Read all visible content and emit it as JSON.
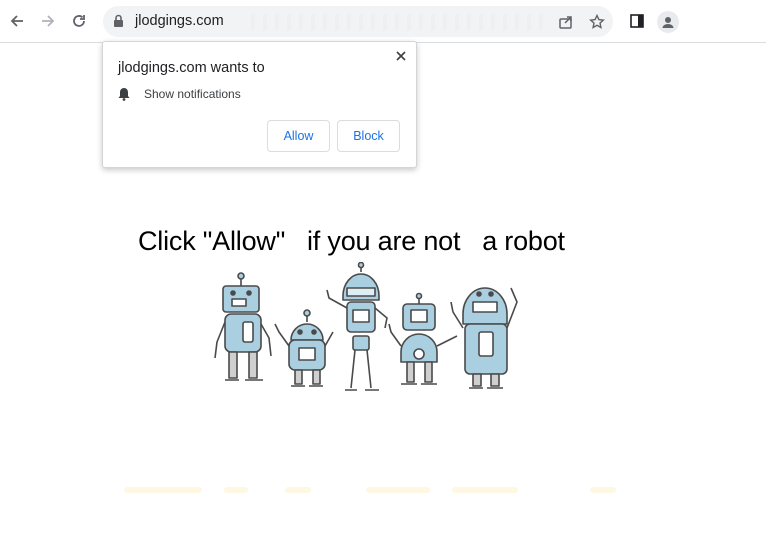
{
  "browser": {
    "url": "jlodgings.com",
    "icons": [
      "back-icon",
      "forward-icon",
      "reload-icon",
      "lock-icon",
      "share-icon",
      "bookmark-star-icon",
      "side-panel-icon",
      "profile-icon"
    ]
  },
  "popup": {
    "title": "jlodgings.com wants to",
    "permission": "Show notifications",
    "allow_label": "Allow",
    "block_label": "Block"
  },
  "page": {
    "headline": "Click \"Allow\"   if you are not   a robot"
  },
  "colors": {
    "accent": "#1a73e8",
    "robot": "#a9cfe0",
    "outline": "#4a4a4a"
  }
}
